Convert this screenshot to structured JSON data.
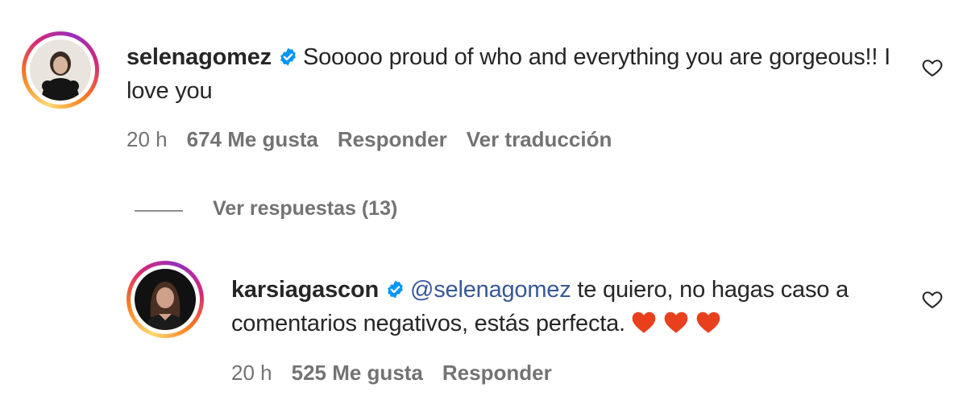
{
  "comments": [
    {
      "username": "selenagomez",
      "verified": true,
      "text": "Sooooo proud of who and everything you are gorgeous!! I love you",
      "time": "20 h",
      "likes": "674 Me gusta",
      "reply_label": "Responder",
      "translate_label": "Ver traducción"
    }
  ],
  "replies_toggle": "Ver respuestas (13)",
  "reply": {
    "username": "karsiagascon",
    "verified": true,
    "mention": "@selenagomez",
    "text": "te quiero, no hagas caso a comentarios negativos, estás perfecta.",
    "emojis": [
      "red-heart",
      "red-heart",
      "red-heart"
    ],
    "time": "20 h",
    "likes": "525 Me gusta",
    "reply_label": "Responder"
  },
  "colors": {
    "verified_badge": "#0095f6",
    "mention": "#385898",
    "secondary_text": "#737373",
    "emoji_heart": "#e8401c"
  }
}
